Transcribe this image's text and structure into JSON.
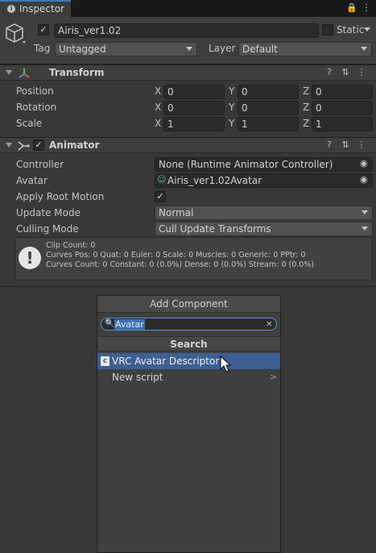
{
  "tab": {
    "icon": "info-icon",
    "label": "Inspector"
  },
  "header": {
    "object_name": "Airis_ver1.02",
    "static_label": "Static",
    "tag_label": "Tag",
    "tag_value": "Untagged",
    "layer_label": "Layer",
    "layer_value": "Default"
  },
  "transform": {
    "title": "Transform",
    "rows": [
      {
        "label": "Position",
        "x": "0",
        "y": "0",
        "z": "0"
      },
      {
        "label": "Rotation",
        "x": "0",
        "y": "0",
        "z": "0"
      },
      {
        "label": "Scale",
        "x": "1",
        "y": "1",
        "z": "1"
      }
    ],
    "axis": {
      "x": "X",
      "y": "Y",
      "z": "Z"
    }
  },
  "animator": {
    "title": "Animator",
    "controller_label": "Controller",
    "controller_value": "None (Runtime Animator Controller)",
    "avatar_label": "Avatar",
    "avatar_value": "Airis_ver1.02Avatar",
    "apply_root_motion_label": "Apply Root Motion",
    "apply_root_motion": true,
    "update_mode_label": "Update Mode",
    "update_mode_value": "Normal",
    "culling_mode_label": "Culling Mode",
    "culling_mode_value": "Cull Update Transforms",
    "info_lines": [
      "Clip Count: 0",
      "Curves Pos: 0 Quat: 0 Euler: 0 Scale: 0 Muscles: 0 Generic: 0 PPtr: 0",
      "Curves Count: 0 Constant: 0 (0.0%) Dense: 0 (0.0%) Stream: 0 (0.0%)"
    ]
  },
  "add_component": {
    "title": "Add Component",
    "search_value": "Avatar",
    "section_label": "Search",
    "items": [
      {
        "label": "VRC Avatar Descriptor",
        "selected": true
      },
      {
        "label": "New script",
        "submenu": true
      }
    ]
  },
  "colors": {
    "accent": "#3d5f93",
    "background": "#383838"
  }
}
